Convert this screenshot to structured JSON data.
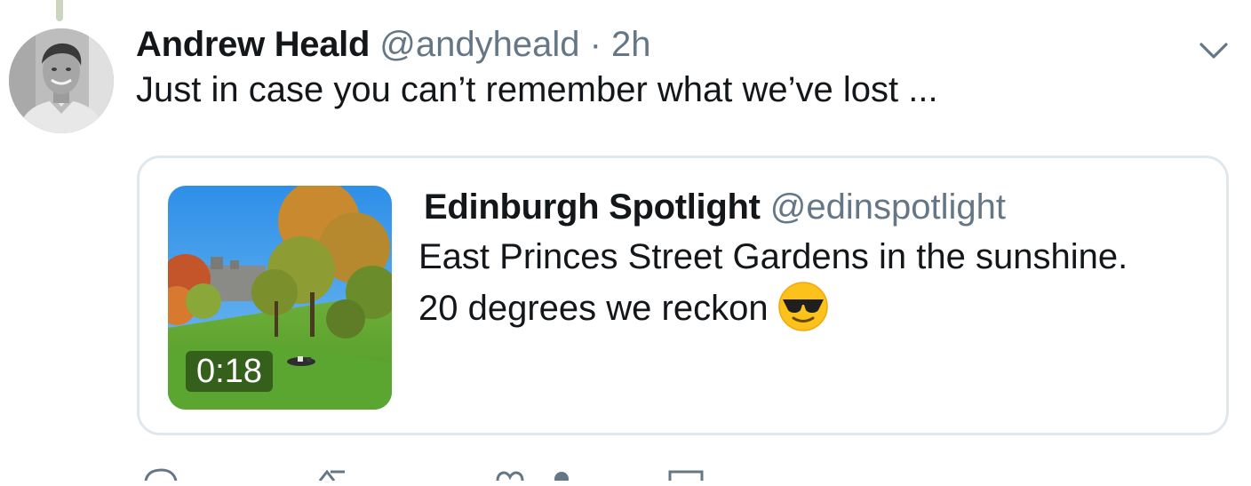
{
  "tweet": {
    "author_name": "Andrew Heald",
    "author_handle": "@andyheald",
    "separator": "·",
    "timestamp": "2h",
    "text": "Just in case you can’t remember what we’ve lost ...",
    "avatar_icon": "profile-photo",
    "menu_icon": "chevron-down-icon"
  },
  "quote": {
    "author_name": "Edinburgh Spotlight",
    "author_handle": "@edinspotlight",
    "text_line1": "East Princes Street Gardens in the sunshine.",
    "text_line2": "20 degrees we reckon",
    "emoji": "smiling-face-with-sunglasses",
    "media": {
      "type": "video",
      "duration": "0:18"
    }
  },
  "actions": [
    "reply-icon",
    "retweet-icon",
    "like-icon",
    "share-icon"
  ],
  "colors": {
    "text": "#14171a",
    "secondary": "#657786",
    "border": "#e1e8ed"
  }
}
